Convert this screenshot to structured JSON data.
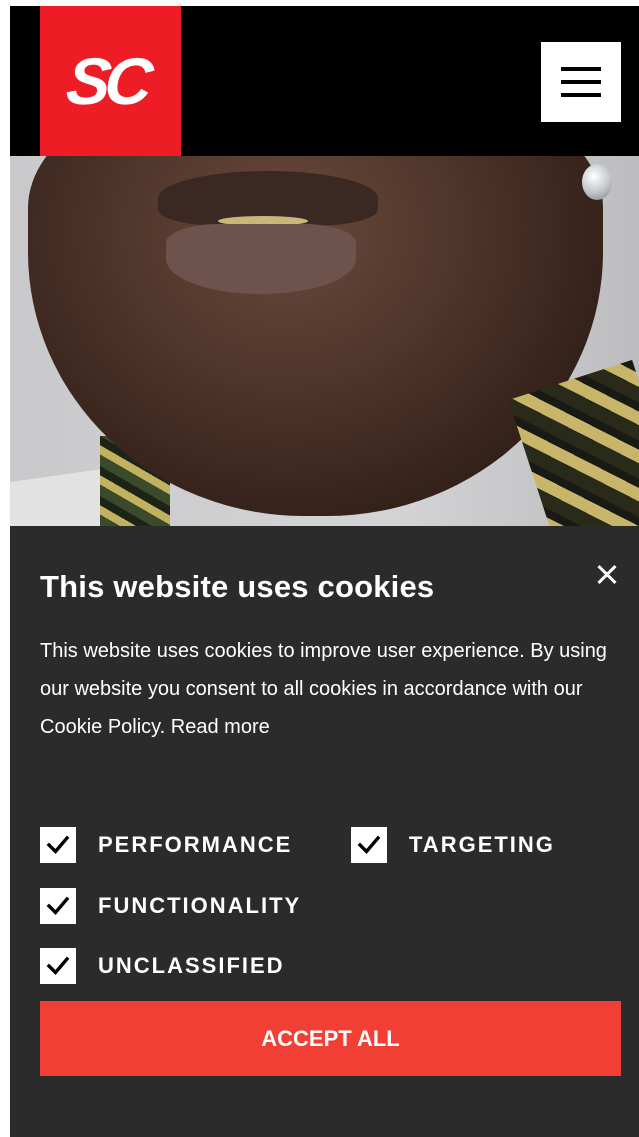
{
  "header": {
    "logo_text": "SC",
    "menu_icon": "hamburger-icon"
  },
  "cookie_banner": {
    "close_icon": "close-icon",
    "title": "This website uses cookies",
    "body": "This website uses cookies to improve user experience. By using our website you consent to all cookies in accordance with our Cookie Policy.",
    "read_more": "Read more",
    "options": [
      {
        "label": "PERFORMANCE",
        "checked": true
      },
      {
        "label": "TARGETING",
        "checked": true
      },
      {
        "label": "FUNCTIONALITY",
        "checked": true
      },
      {
        "label": "UNCLASSIFIED",
        "checked": true
      }
    ],
    "accept_label": "ACCEPT ALL"
  },
  "colors": {
    "brand_red": "#ee1c25",
    "accept_button": "#f23f36",
    "panel_background": "#2b2b2b",
    "header_background": "#000000"
  }
}
